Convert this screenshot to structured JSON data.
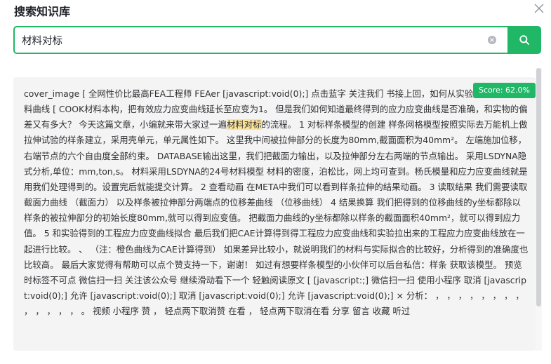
{
  "dialog": {
    "title": "搜索知识库"
  },
  "search": {
    "value": "材料对标",
    "placeholder": ""
  },
  "result": {
    "score": "Score: 62.0%",
    "text_before": "cover_image [ 全网性价比最高FEA工程师 FEAer [javascript:void(0);] 点击蓝字 关注我们 书接上回，如何从实验中处理CAE材料曲线 [ COOK材料本构，把有效应力应变曲线延长至应变为1。 但是我们如何知道最终得到的应力应变曲线是否准确，和实物的偏差又有多大？ 今天这篇文章，小编就来带大家过一遍",
    "highlight": "材料对标",
    "text_after": "的流程。 1 对标样条模型的创建 样条网格模型按照实际去万能机上做拉伸试验的样条建立，采用壳单元，单元属性如下。 这里我中间被拉伸部分的长度为80mm,截面面积为40mm²。 左端施加位移，右端节点的六个自由度全部约束。 DATABASE输出这里，我们把截面力输出，以及拉伸部分左右两端的节点输出。 采用LSDYNA隐式分析,单位：mm,ton,s。 材料采用LSDYNA的24号材料模型 材料的密度，泊松比，网上均可查到。杨氏模量和应力应变曲线就是用我们处理得到的。设置完后就能提交计算。 2 查看动画 在META中我们可以看到样条拉伸的结果动画。 3 读取结果 我们需要读取截面力曲线 （截面力） 以及样条被拉伸部分两端点的位移差曲线 （位移曲线） 4 结果换算 我们把得到的位移曲线的y坐标都除以样条的被拉伸部分的初始长度80mm,就可以得到应变值。 把截面力曲线的y坐标都除以样条的截面面积40mm²，就可以得到应力值。 5 和实验得到的工程应力应变曲线拟合 最后我们把CAE计算得到得工程应力应变曲线和实验拉出来的工程应力应变曲线放在一起进行比较。 、 （注：橙色曲线为CAE计算得到） 如果差异比较小，就说明我们的材料与实际拟合的比较好，分析得到的准确度也比较高。 最后大家觉得有帮助可以点个赞支持一下，谢谢！ 如过有想要样条模型的小伙伴可以后台私信：样条 获取该模型。 预览时标签不可点 微信扫一扫 关注该公众号 继续滑动看下一个 轻触阅读原文 [ [javascript:;] 微信扫一扫 使用小程序 取消 [javascript:void(0);] 允许 [javascript:void(0);] 取消 [javascript:void(0);] 允许 [javascript:void(0);] × 分析： ， ， ， ， ， ， ， ， ， ， ， ， ， 。 视频 小程序 赞 ， 轻点两下取消赞 在看 ， 轻点两下取消在看 分享 留言 收藏 听过"
  },
  "icons": {
    "close": "close-icon",
    "clear": "clear-circle-icon",
    "search": "search-icon"
  },
  "colors": {
    "accent": "#20b766",
    "highlight": "#fbe39a",
    "card_bg": "#f4f4f5"
  }
}
